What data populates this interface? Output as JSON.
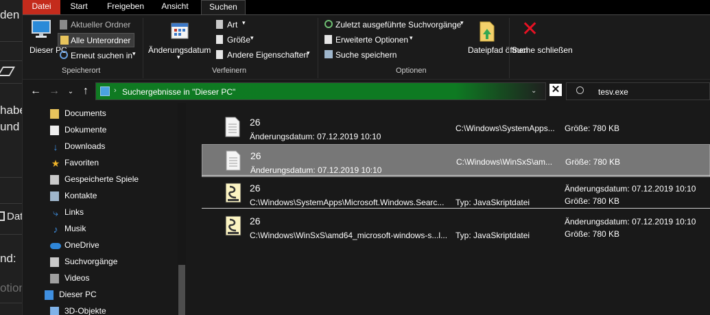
{
  "background_window": {
    "fragments": [
      "den",
      "habe",
      "und",
      "Dat",
      "nd:",
      "otion"
    ]
  },
  "tabs": [
    "Datei",
    "Start",
    "Freigeben",
    "Ansicht",
    "Suchen"
  ],
  "ribbon": {
    "location": {
      "this_pc": "Dieser PC",
      "current_folder": "Aktueller Ordner",
      "all_subfolders": "Alle Unterordner",
      "search_again": "Erneut suchen in",
      "group_label": "Speicherort"
    },
    "refine": {
      "date_modified": "Änderungsdatum",
      "kind": "Art",
      "size": "Größe",
      "other_properties": "Andere Eigenschaften",
      "group_label": "Verfeinern"
    },
    "options": {
      "recent_searches": "Zuletzt ausgeführte Suchvorgänge",
      "advanced_options": "Erweiterte Optionen",
      "save_search": "Suche speichern",
      "group_label": "Optionen"
    },
    "open_file_location": "Dateipfad öffnen",
    "close_search": "Suche schließen"
  },
  "address": {
    "text": "Suchergebnisse in \"Dieser PC\"",
    "clear": "✕",
    "search_value": "tesv.exe"
  },
  "nav_items": [
    {
      "label": "Documents",
      "icon": "folder-icon"
    },
    {
      "label": "Dokumente",
      "icon": "document-icon"
    },
    {
      "label": "Downloads",
      "icon": "download-icon"
    },
    {
      "label": "Favoriten",
      "icon": "star-icon"
    },
    {
      "label": "Gespeicherte Spiele",
      "icon": "games-icon"
    },
    {
      "label": "Kontakte",
      "icon": "contacts-icon"
    },
    {
      "label": "Links",
      "icon": "link-icon"
    },
    {
      "label": "Musik",
      "icon": "music-icon"
    },
    {
      "label": "OneDrive",
      "icon": "cloud-icon"
    },
    {
      "label": "Suchvorgänge",
      "icon": "search-icon"
    },
    {
      "label": "Videos",
      "icon": "video-icon"
    },
    {
      "label": "Dieser PC",
      "icon": "computer-icon"
    },
    {
      "label": "3D-Objekte",
      "icon": "cube-icon"
    }
  ],
  "results": [
    {
      "name": "26",
      "sub": "Änderungsdatum: 07.12.2019 10:10",
      "path": "C:\\Windows\\SystemApps...",
      "size": "Größe: 780 KB",
      "icon": "text-file-icon"
    },
    {
      "name": "26",
      "sub": "Änderungsdatum: 07.12.2019 10:10",
      "path": "C:\\Windows\\WinSxS\\am...",
      "size": "Größe: 780 KB",
      "icon": "text-file-icon"
    },
    {
      "name": "26",
      "sub": "C:\\Windows\\SystemApps\\Microsoft.Windows.Searc...",
      "type": "Typ: JavaSkriptdatei",
      "date": "Änderungsdatum: 07.12.2019 10:10",
      "size": "Größe: 780 KB",
      "icon": "script-file-icon"
    },
    {
      "name": "26",
      "sub": "C:\\Windows\\WinSxS\\amd64_microsoft-windows-s...l...",
      "type": "Typ: JavaSkriptdatei",
      "date": "Änderungsdatum: 07.12.2019 10:10",
      "size": "Größe: 780 KB",
      "icon": "script-file-icon"
    }
  ]
}
